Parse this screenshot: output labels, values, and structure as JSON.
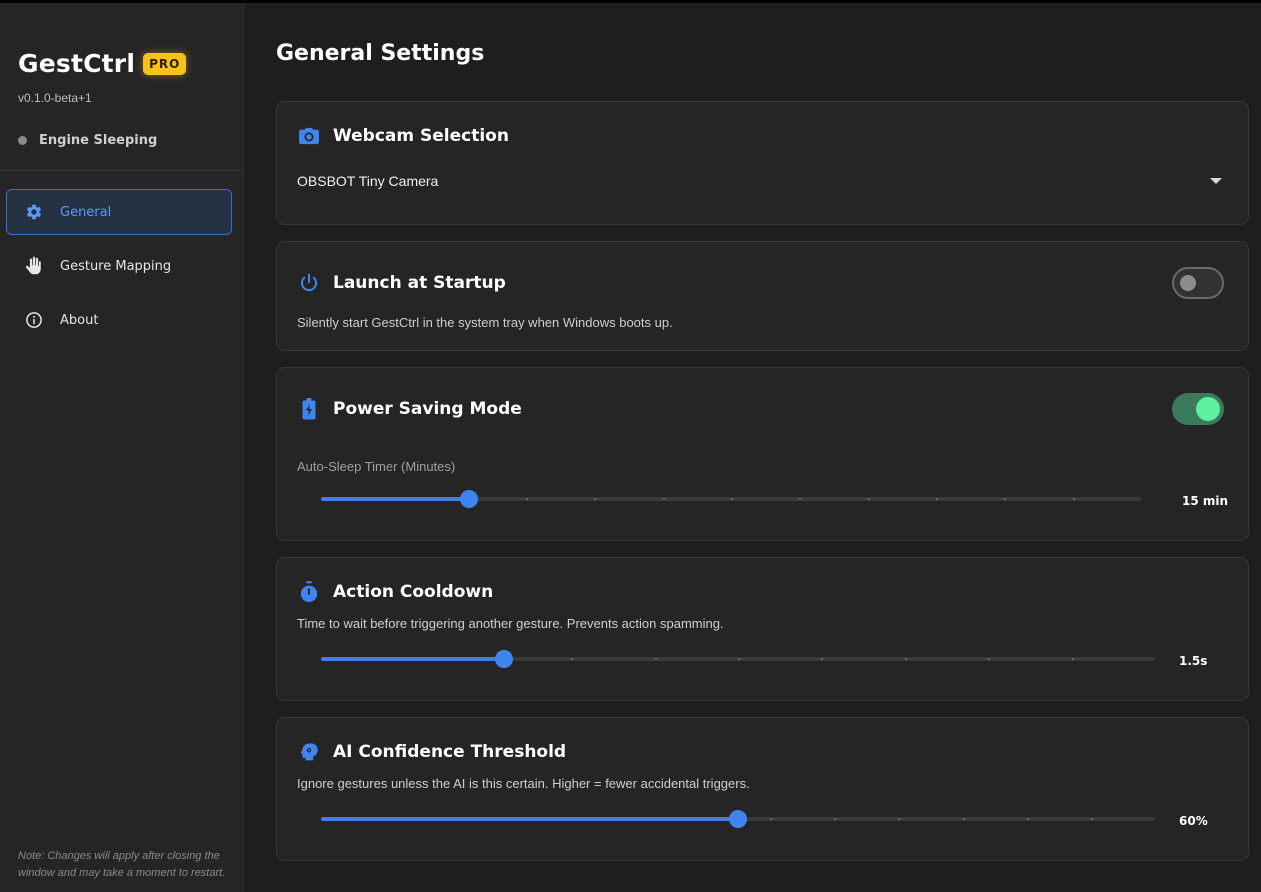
{
  "sidebar": {
    "app_name": "GestCtrl",
    "badge": "PRO",
    "version": "v0.1.0-beta+1",
    "engine_status": "Engine Sleeping",
    "nav": [
      {
        "label": "General",
        "icon": "gear-icon",
        "active": true
      },
      {
        "label": "Gesture Mapping",
        "icon": "hand-icon",
        "active": false
      },
      {
        "label": "About",
        "icon": "info-icon",
        "active": false
      }
    ],
    "note": "Note: Changes will apply after closing the window and may take a moment to restart."
  },
  "main": {
    "title": "General Settings",
    "webcam": {
      "title": "Webcam Selection",
      "icon": "camera-icon",
      "selected": "OBSBOT Tiny Camera"
    },
    "startup": {
      "title": "Launch at Startup",
      "icon": "power-icon",
      "description": "Silently start GestCtrl in the system tray when Windows boots up.",
      "enabled": false
    },
    "power_saving": {
      "title": "Power Saving Mode",
      "icon": "battery-charging-icon",
      "enabled": true,
      "slider_label": "Auto-Sleep Timer (Minutes)",
      "value_text": "15 min",
      "fraction": 0.18,
      "ticks": 12
    },
    "cooldown": {
      "title": "Action Cooldown",
      "icon": "stopwatch-icon",
      "description": "Time to wait before triggering another gesture. Prevents action spamming.",
      "value_text": "1.5s",
      "fraction": 0.22,
      "ticks": 10
    },
    "confidence": {
      "title": "AI Confidence Threshold",
      "icon": "brain-icon",
      "description": "Ignore gestures unless the AI is this certain. Higher = fewer accidental triggers.",
      "value_text": "60%",
      "fraction": 0.5,
      "ticks": 13
    }
  },
  "colors": {
    "accent": "#3f85f0",
    "badge": "#f7c21a",
    "toggle_on": "#5ef0a0"
  }
}
